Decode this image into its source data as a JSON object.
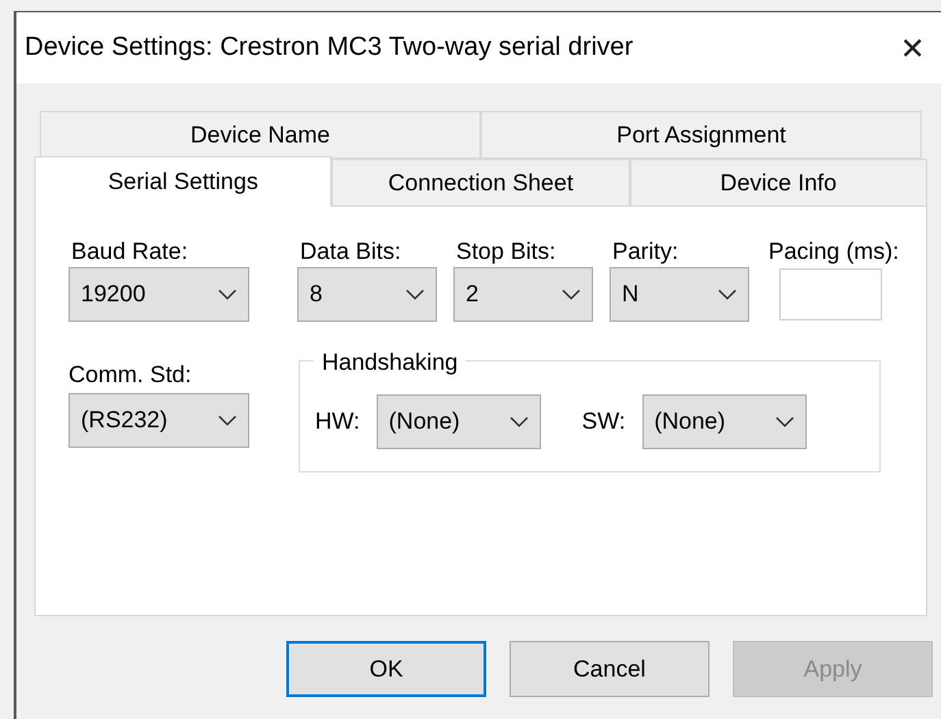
{
  "window": {
    "title": "Device Settings: Crestron MC3 Two-way serial driver",
    "close": "✕"
  },
  "tab_rows": [
    [
      {
        "label": "Device Name",
        "selected": false
      },
      {
        "label": "Port Assignment",
        "selected": false
      }
    ],
    [
      {
        "label": "Serial Settings",
        "selected": true
      },
      {
        "label": "Connection Sheet",
        "selected": false
      },
      {
        "label": "Device Info",
        "selected": false
      }
    ]
  ],
  "fields": [
    {
      "kind": "combo",
      "label": "Baud Rate:",
      "value": "19200"
    },
    {
      "kind": "combo",
      "label": "Data Bits:",
      "value": "8"
    },
    {
      "kind": "combo",
      "label": "Stop Bits:",
      "value": "2"
    },
    {
      "kind": "combo",
      "label": "Parity:",
      "value": "N"
    },
    {
      "kind": "text",
      "label": "Pacing (ms):"
    }
  ],
  "comm_std": {
    "label": "Comm. Std:",
    "value": "(RS232)"
  },
  "handshaking": {
    "title": "Handshaking",
    "items": [
      {
        "label": "HW:",
        "value": "(None)"
      },
      {
        "label": "SW:",
        "value": "(None)"
      }
    ]
  },
  "buttons": [
    {
      "label": "OK",
      "default": true,
      "disabled": false
    },
    {
      "label": "Cancel",
      "default": false,
      "disabled": false
    },
    {
      "label": "Apply",
      "default": false,
      "disabled": true
    }
  ]
}
